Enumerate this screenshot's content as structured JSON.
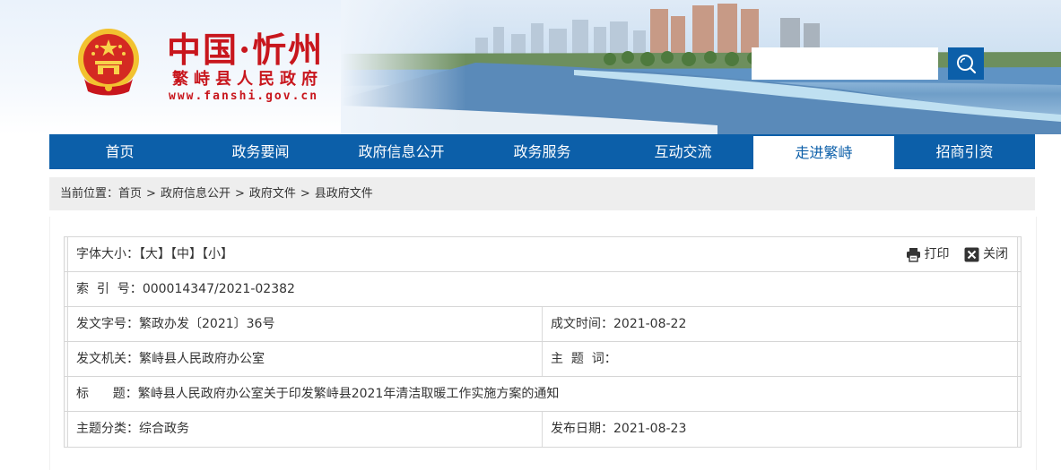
{
  "header": {
    "logo_title": "中国·忻州",
    "logo_subtitle": "繁峙县人民政府",
    "logo_url": "www.fanshi.gov.cn",
    "search_placeholder": ""
  },
  "nav": {
    "items": [
      {
        "label": "首页"
      },
      {
        "label": "政务要闻"
      },
      {
        "label": "政府信息公开"
      },
      {
        "label": "政务服务"
      },
      {
        "label": "互动交流"
      },
      {
        "label": "走进繁峙"
      },
      {
        "label": "招商引资"
      }
    ],
    "active_index": 5
  },
  "breadcrumb": {
    "prefix": "当前位置：",
    "items": [
      "首页",
      "政府信息公开",
      "政府文件",
      "县政府文件"
    ],
    "separator": ">"
  },
  "toolbar": {
    "font_size_label": "字体大小：",
    "sizes": [
      "【大】",
      "【中】",
      "【小】"
    ],
    "print_label": "打印",
    "close_label": "关闭"
  },
  "meta": {
    "index_label": "索  引  号：",
    "index_value": "000014347/2021-02382",
    "doc_no_label": "发文字号：",
    "doc_no_value": "繁政办发〔2021〕36号",
    "created_label": "成文时间：",
    "created_value": "2021-08-22",
    "issuer_label": "发文机关：",
    "issuer_value": "繁峙县人民政府办公室",
    "keywords_label": "主  题  词：",
    "keywords_value": "",
    "title_label": "标      题：",
    "title_value": "繁峙县人民政府办公室关于印发繁峙县2021年清洁取暖工作实施方案的通知",
    "category_label": "主题分类：",
    "category_value": "综合政务",
    "published_label": "发布日期：",
    "published_value": "2021-08-23"
  },
  "colors": {
    "brand_red": "#c8161d",
    "nav_blue": "#0c5fa9",
    "breadcrumb_bg": "#eeeeee"
  }
}
